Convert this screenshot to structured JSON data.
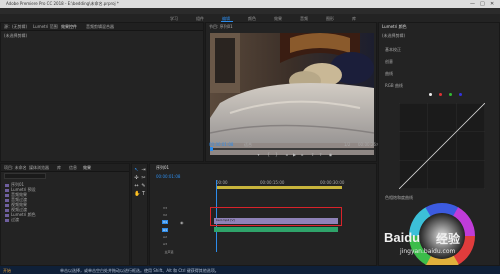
{
  "window": {
    "title": "Adobe Premiere Pro CC 2018 - E:\\bedding\\未命名.prproj *",
    "min": "—",
    "max": "□",
    "close": "✕"
  },
  "workspaces": [
    "学习",
    "组件",
    "编辑",
    "颜色",
    "效果",
    "音频",
    "图形",
    "库"
  ],
  "source_panel": {
    "tabs": [
      "源：(无剪辑)",
      "Lumetri 范围",
      "效果控件",
      "音频剪辑混合器"
    ],
    "message": "(未选择剪辑)"
  },
  "program_monitor": {
    "tab": "节目: 序列01",
    "timecode_current": "00:00:01:08",
    "fit": "适合",
    "ratio": "1/2",
    "timecode_duration": "00:00:26:00"
  },
  "lumetri": {
    "tab": "Lumetri 颜色",
    "subtitle": "(未选择剪辑)",
    "sections": [
      "基本校正",
      "创意",
      "曲线",
      "RGB 曲线"
    ],
    "wheel_label": "色相饱和度曲线"
  },
  "project_panel": {
    "tabs": [
      "项目: 未命名",
      "媒体浏览器",
      "库",
      "信息",
      "效果"
    ],
    "items": [
      "序列01",
      "Lumetri 预设",
      "音频效果",
      "音频过渡",
      "视频效果",
      "视频过渡",
      "Lumetri 颜色",
      "过渡"
    ]
  },
  "timeline": {
    "tab": "序列01",
    "timecode": "00:00:01:08",
    "ruler": [
      "00:00",
      "00:00:15:00",
      "00:00:30:00"
    ],
    "tracks": [
      "V3",
      "V2",
      "V1",
      "A1",
      "A2",
      "A3",
      "主声道"
    ],
    "clip_label": "bed.mp4 [V]"
  },
  "taskbar": {
    "start": "开始",
    "status": "单击以选择，或单击空白处并拖动以进行框选。使用 Shift、Alt 和 Ctrl 键获得其他选项。"
  },
  "watermark": {
    "brand": "Baidu",
    "word": "经验",
    "site": "jingyan.baidu.com"
  },
  "colors": {
    "accent": "#2d8ceb",
    "highlight": "#d9232a",
    "clip": "#2fa36a"
  }
}
